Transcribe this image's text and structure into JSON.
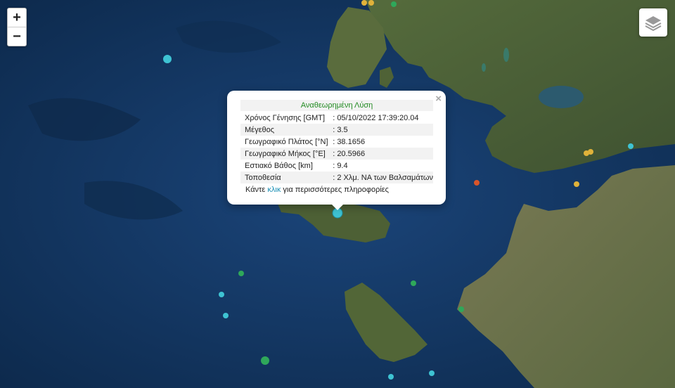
{
  "zoom": {
    "in_label": "+",
    "out_label": "−"
  },
  "layers_icon": "layers-icon",
  "popup": {
    "close_label": "×",
    "title": "Αναθεωρημένη Λύση",
    "rows": [
      {
        "label": "Χρόνος Γένησης [GMT]",
        "value": ": 05/10/2022 17:39:20.04"
      },
      {
        "label": "Μέγεθος",
        "value": ": 3.5"
      },
      {
        "label": "Γεωγραφικό Πλάτος [°N]",
        "value": ": 38.1656"
      },
      {
        "label": "Γεωγραφικό Μήκος [°E]",
        "value": ": 20.5966"
      },
      {
        "label": "Εστιακό Βάθος [km]",
        "value": ": 9.4"
      },
      {
        "label": "Τοποθεσία",
        "value": ": 2 Χλμ. ΝΑ των Βαλσαμάτων"
      }
    ],
    "more_prefix": "Κάντε ",
    "more_link": "κλικ",
    "more_suffix": " για περισσότερες πληροφορίες"
  },
  "colors": {
    "sea": "#123660",
    "land": "#4a5e35",
    "cyan": "#3ec3d3",
    "green": "#2fa85a",
    "yellow": "#e0b23a",
    "orange": "#d9552a",
    "title_green": "#228b22"
  }
}
